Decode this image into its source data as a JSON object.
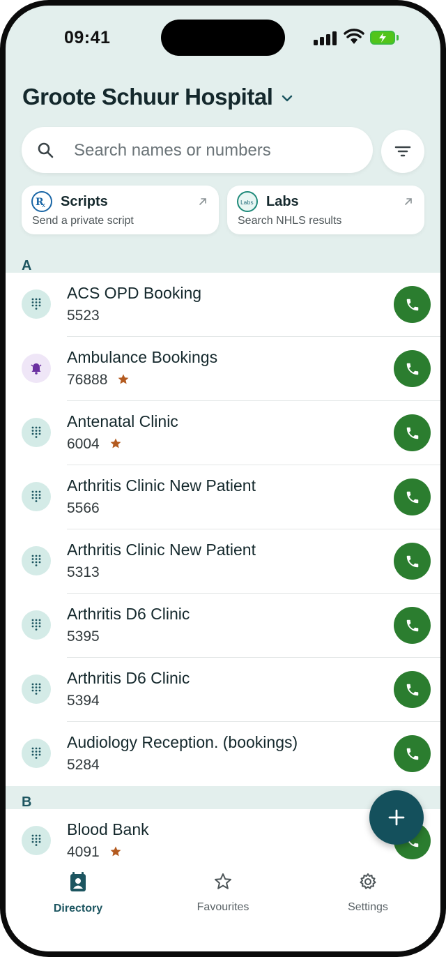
{
  "status_bar": {
    "time": "09:41"
  },
  "header": {
    "title": "Groote Schuur Hospital"
  },
  "search": {
    "placeholder": "Search names or numbers"
  },
  "quick_actions": [
    {
      "title": "Scripts",
      "subtitle": "Send a private script",
      "icon": "rx-icon"
    },
    {
      "title": "Labs",
      "subtitle": "Search NHLS results",
      "icon": "labs-icon",
      "icon_text": "Labs"
    }
  ],
  "sections": [
    {
      "letter": "A",
      "entries": [
        {
          "name": "ACS OPD Booking",
          "number": "5523",
          "icon": "dialpad-icon",
          "favourite": false
        },
        {
          "name": "Ambulance Bookings",
          "number": "76888",
          "icon": "alarm-bell-icon",
          "favourite": true
        },
        {
          "name": "Antenatal Clinic",
          "number": "6004",
          "icon": "dialpad-icon",
          "favourite": true
        },
        {
          "name": "Arthritis Clinic New Patient",
          "number": "5566",
          "icon": "dialpad-icon",
          "favourite": false
        },
        {
          "name": "Arthritis Clinic New Patient",
          "number": "5313",
          "icon": "dialpad-icon",
          "favourite": false
        },
        {
          "name": "Arthritis D6 Clinic",
          "number": "5395",
          "icon": "dialpad-icon",
          "favourite": false
        },
        {
          "name": "Arthritis D6 Clinic",
          "number": "5394",
          "icon": "dialpad-icon",
          "favourite": false
        },
        {
          "name": "Audiology Reception. (bookings)",
          "number": "5284",
          "icon": "dialpad-icon",
          "favourite": false
        }
      ]
    },
    {
      "letter": "B",
      "entries": [
        {
          "name": "Blood Bank",
          "number": "4091",
          "icon": "dialpad-icon",
          "favourite": true
        }
      ]
    }
  ],
  "tabs": [
    {
      "label": "Directory",
      "icon": "contact-book-icon",
      "active": true
    },
    {
      "label": "Favourites",
      "icon": "star-icon",
      "active": false
    },
    {
      "label": "Settings",
      "icon": "gear-icon",
      "active": false
    }
  ],
  "colors": {
    "accent": "#1c5560",
    "call_green": "#2b7d2f",
    "favourite_star": "#b35a1f",
    "header_bg": "#e3efed"
  }
}
